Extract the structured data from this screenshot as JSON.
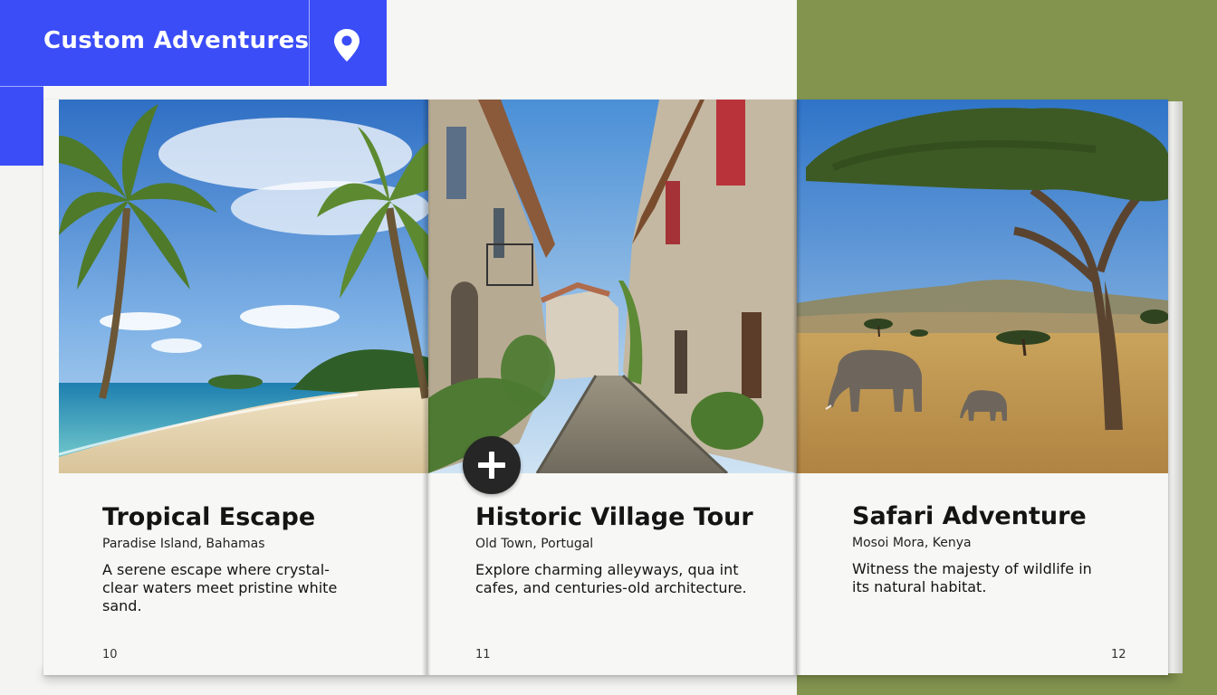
{
  "brand": {
    "title": "Custom Adventures",
    "accent_color": "#3b4df7",
    "pin_icon": "map-pin-icon"
  },
  "background": {
    "right_panel_color": "#83944f"
  },
  "add_button": {
    "icon": "plus-icon"
  },
  "pages": [
    {
      "title": "Tropical Escape",
      "location": "Paradise Island, Bahamas",
      "description": "A serene escape where crystal-clear waters meet pristine white sand.",
      "page_number": "10",
      "image": "tropical beach with palm trees"
    },
    {
      "title": "Historic Village Tour",
      "location": "Old Town, Portugal",
      "description": "Explore charming alleyways, qua int cafes, and centuries-old architecture.",
      "page_number": "11",
      "image": "cobblestone village street"
    },
    {
      "title": "Safari Adventure",
      "location": "Mosoi Mora, Kenya",
      "description": "Witness the majesty of wildlife in its natural habitat.",
      "page_number": "12",
      "image": "savanna with elephants and acacia tree"
    }
  ]
}
